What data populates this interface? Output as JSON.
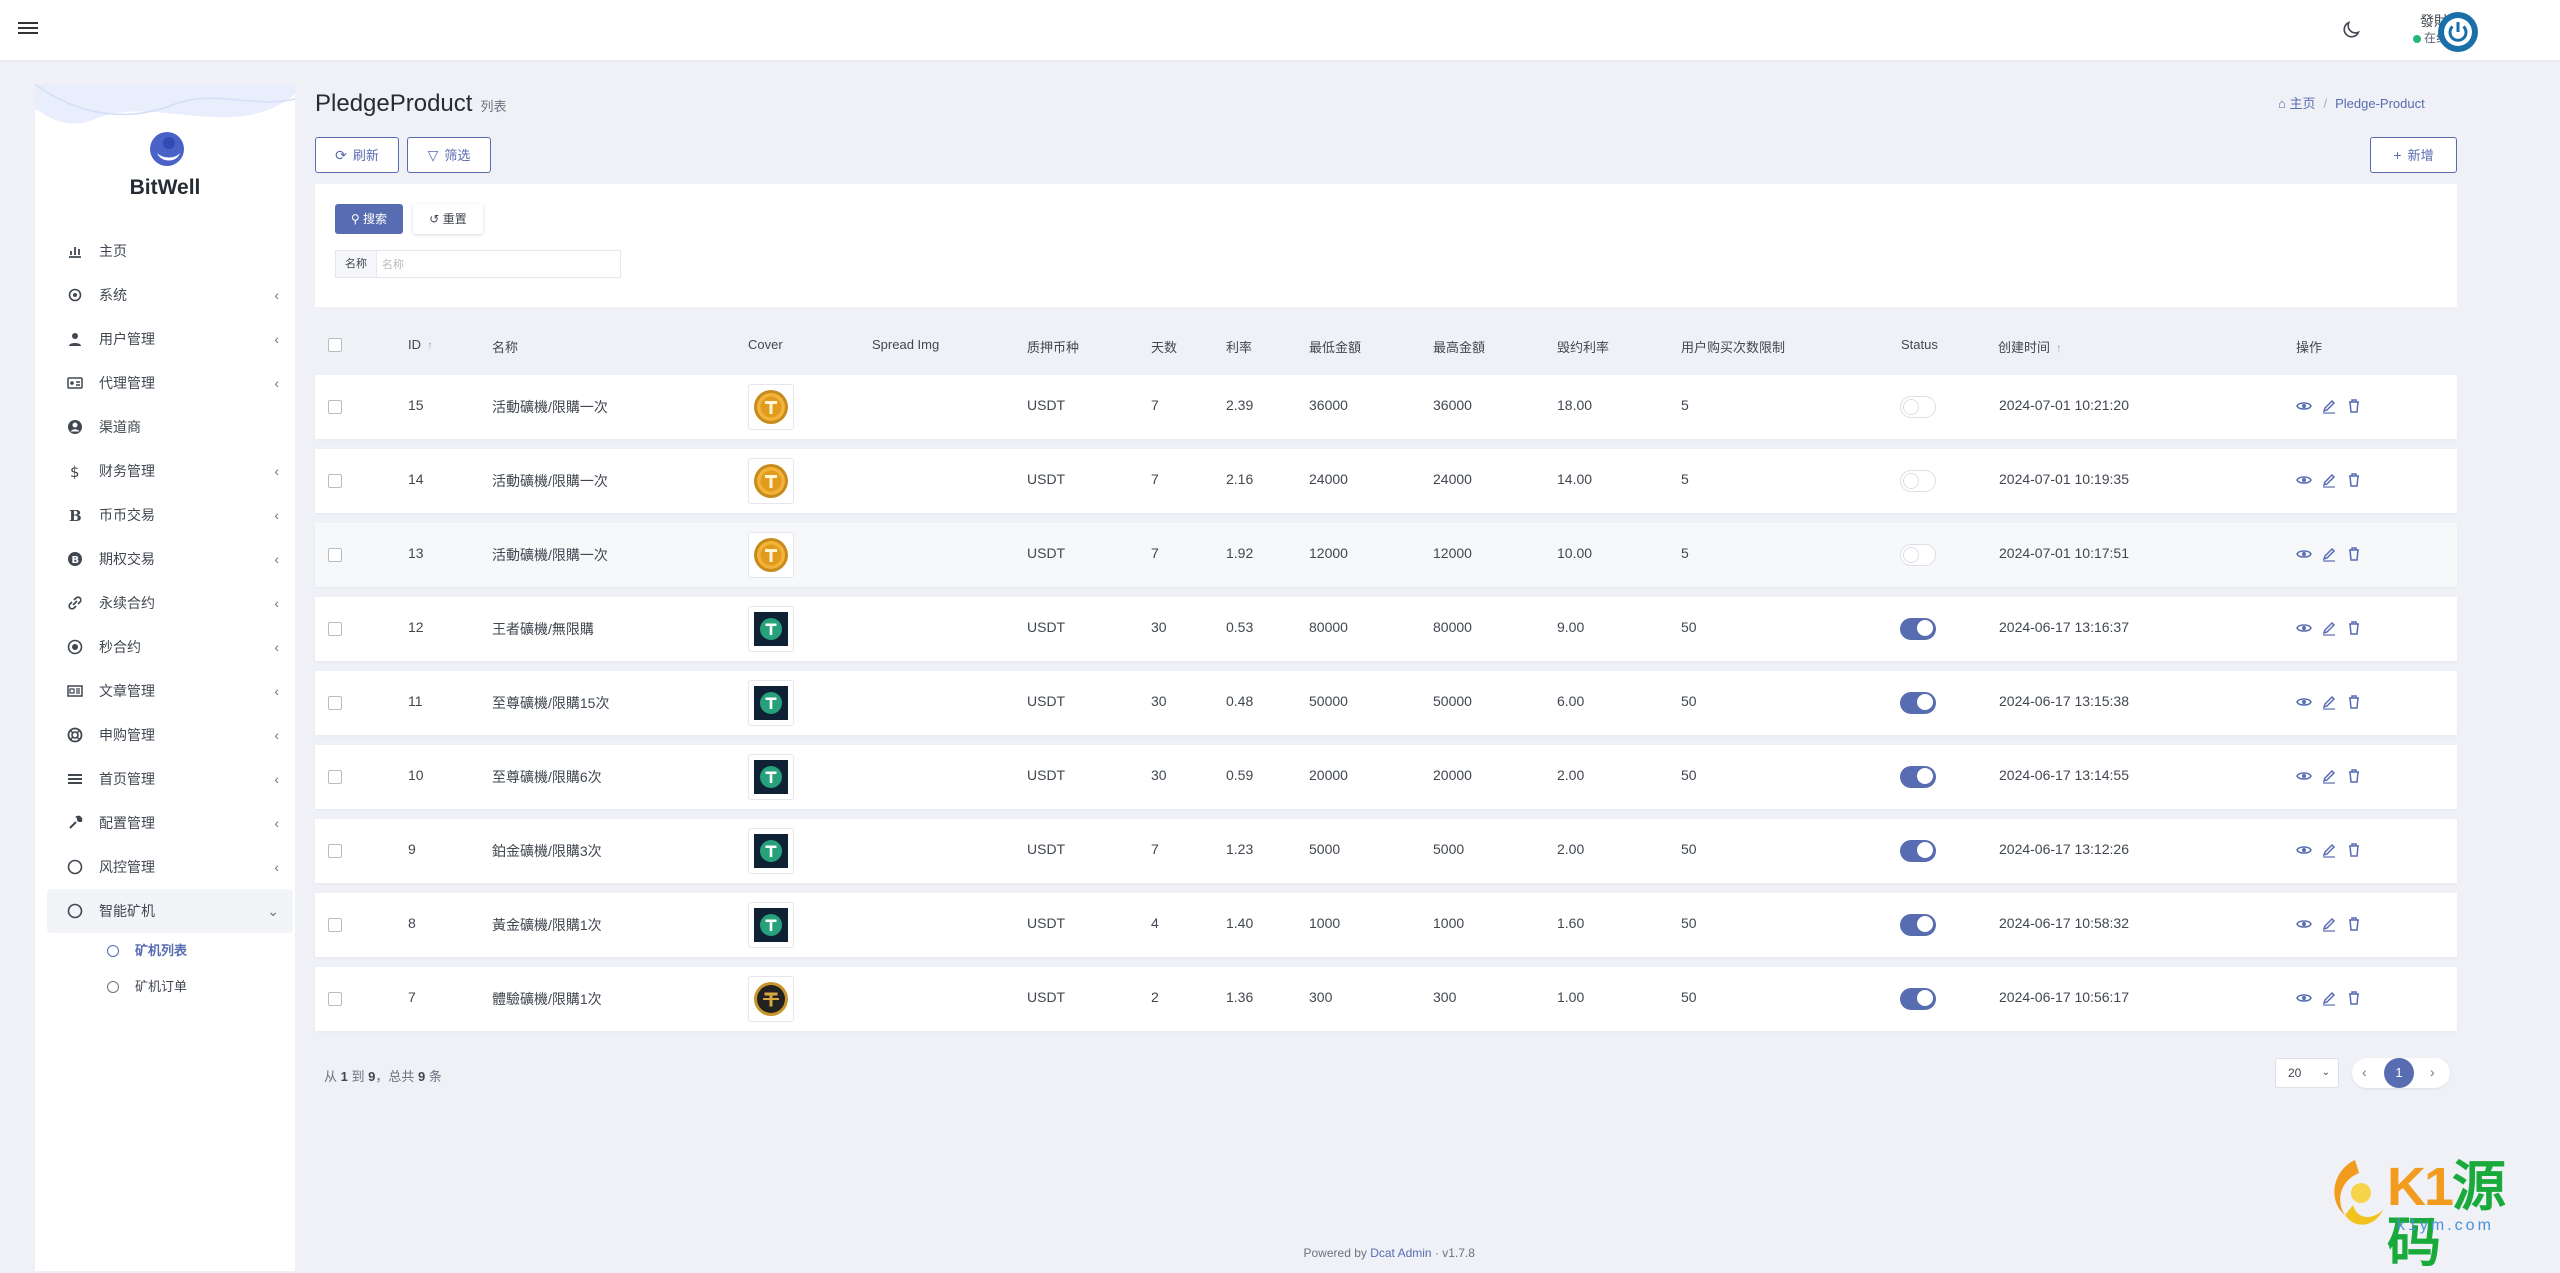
{
  "header": {
    "user_name": "發財",
    "user_status": "在线",
    "avatar_icon": "power-icon"
  },
  "sidebar": {
    "brand": "BitWell",
    "items": [
      {
        "label": "主页",
        "icon": "dashboard-icon",
        "has_children": false
      },
      {
        "label": "系统",
        "icon": "gear-icon",
        "has_children": true
      },
      {
        "label": "用户管理",
        "icon": "user-icon",
        "has_children": true
      },
      {
        "label": "代理管理",
        "icon": "id-card-icon",
        "has_children": true
      },
      {
        "label": "渠道商",
        "icon": "user-circle-icon",
        "has_children": false
      },
      {
        "label": "财务管理",
        "icon": "dollar-icon",
        "has_children": true
      },
      {
        "label": "币币交易",
        "icon": "bitcoin-icon",
        "has_children": true
      },
      {
        "label": "期权交易",
        "icon": "bitcoin-circle-icon",
        "has_children": true
      },
      {
        "label": "永续合约",
        "icon": "link-icon",
        "has_children": true
      },
      {
        "label": "秒合约",
        "icon": "dot-circle-icon",
        "has_children": true
      },
      {
        "label": "文章管理",
        "icon": "newspaper-icon",
        "has_children": true
      },
      {
        "label": "申购管理",
        "icon": "support-icon",
        "has_children": true
      },
      {
        "label": "首页管理",
        "icon": "list-icon",
        "has_children": true
      },
      {
        "label": "配置管理",
        "icon": "wrench-icon",
        "has_children": true
      },
      {
        "label": "风控管理",
        "icon": "circle-icon",
        "has_children": true
      },
      {
        "label": "智能矿机",
        "icon": "circle-icon",
        "has_children": true,
        "open": true
      }
    ],
    "sub_items": [
      {
        "label": "矿机列表",
        "active": true
      },
      {
        "label": "矿机订单",
        "active": false
      }
    ]
  },
  "page": {
    "title": "PledgeProduct",
    "subtitle": "列表",
    "breadcrumb_home": "主页",
    "breadcrumb_current": "Pledge-Product"
  },
  "toolbar": {
    "refresh_label": "刷新",
    "filter_label": "筛选",
    "new_label": "新增"
  },
  "filter": {
    "search_label": "搜索",
    "reset_label": "重置",
    "name_label": "名称",
    "name_placeholder": "名称"
  },
  "table": {
    "columns": {
      "id": "ID",
      "name": "名称",
      "cover": "Cover",
      "spread_img": "Spread Img",
      "coin": "质押币种",
      "days": "天数",
      "rate": "利率",
      "min": "最低金額",
      "max": "最高金額",
      "breach_rate": "毁约利率",
      "limit": "用户购买次数限制",
      "status": "Status",
      "created": "创建时间",
      "actions": "操作"
    },
    "rows": [
      {
        "id": "15",
        "name": "活動礦機/限購一次",
        "cover": "gold",
        "coin": "USDT",
        "days": "7",
        "rate": "2.39",
        "min": "36000",
        "max": "36000",
        "breach_rate": "18.00",
        "limit": "5",
        "status": false,
        "created": "2024-07-01 10:21:20"
      },
      {
        "id": "14",
        "name": "活動礦機/限購一次",
        "cover": "gold",
        "coin": "USDT",
        "days": "7",
        "rate": "2.16",
        "min": "24000",
        "max": "24000",
        "breach_rate": "14.00",
        "limit": "5",
        "status": false,
        "created": "2024-07-01 10:19:35"
      },
      {
        "id": "13",
        "name": "活動礦機/限購一次",
        "cover": "gold",
        "coin": "USDT",
        "days": "7",
        "rate": "1.92",
        "min": "12000",
        "max": "12000",
        "breach_rate": "10.00",
        "limit": "5",
        "status": false,
        "created": "2024-07-01 10:17:51"
      },
      {
        "id": "12",
        "name": "王者礦機/無限購",
        "cover": "dark",
        "coin": "USDT",
        "days": "30",
        "rate": "0.53",
        "min": "80000",
        "max": "80000",
        "breach_rate": "9.00",
        "limit": "50",
        "status": true,
        "created": "2024-06-17 13:16:37"
      },
      {
        "id": "11",
        "name": "至尊礦機/限購15次",
        "cover": "dark",
        "coin": "USDT",
        "days": "30",
        "rate": "0.48",
        "min": "50000",
        "max": "50000",
        "breach_rate": "6.00",
        "limit": "50",
        "status": true,
        "created": "2024-06-17 13:15:38"
      },
      {
        "id": "10",
        "name": "至尊礦機/限購6次",
        "cover": "dark",
        "coin": "USDT",
        "days": "30",
        "rate": "0.59",
        "min": "20000",
        "max": "20000",
        "breach_rate": "2.00",
        "limit": "50",
        "status": true,
        "created": "2024-06-17 13:14:55"
      },
      {
        "id": "9",
        "name": "鉑金礦機/限購3次",
        "cover": "dark",
        "coin": "USDT",
        "days": "7",
        "rate": "1.23",
        "min": "5000",
        "max": "5000",
        "breach_rate": "2.00",
        "limit": "50",
        "status": true,
        "created": "2024-06-17 13:12:26"
      },
      {
        "id": "8",
        "name": "黃金礦機/限購1次",
        "cover": "dark",
        "coin": "USDT",
        "days": "4",
        "rate": "1.40",
        "min": "1000",
        "max": "1000",
        "breach_rate": "1.60",
        "limit": "50",
        "status": true,
        "created": "2024-06-17 10:58:32"
      },
      {
        "id": "7",
        "name": "體驗礦機/限購1次",
        "cover": "black-gold",
        "coin": "USDT",
        "days": "2",
        "rate": "1.36",
        "min": "300",
        "max": "300",
        "breach_rate": "1.00",
        "limit": "50",
        "status": true,
        "created": "2024-06-17 10:56:17"
      }
    ]
  },
  "pagination": {
    "summary_prefix": "从",
    "from": "1",
    "to_word": "到",
    "to": "9",
    "total_prefix": "，总共",
    "total": "9",
    "total_suffix": "条",
    "per_page": "20",
    "current_page": "1"
  },
  "footer": {
    "powered_by": "Powered by",
    "link": "Dcat Admin",
    "version": "· v1.7.8"
  },
  "watermark": {
    "text_k1": "K1",
    "text_yuanma": "源码",
    "url": "k1ym.com"
  },
  "colors": {
    "accent": "#586cb1",
    "online": "#21b978",
    "background": "#eff1f6"
  }
}
